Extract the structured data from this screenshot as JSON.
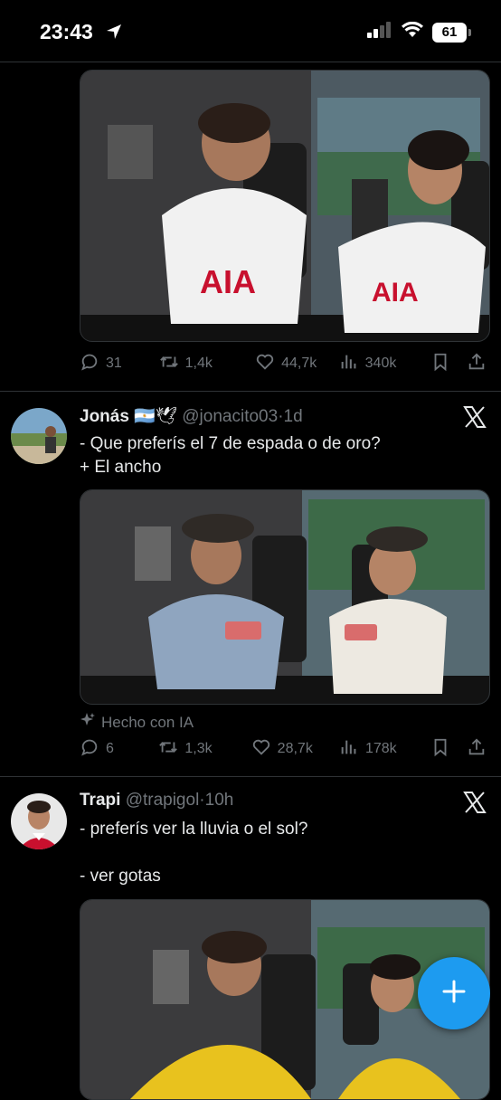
{
  "status_bar": {
    "time": "23:43",
    "battery": "61"
  },
  "tweets": [
    {
      "media_alt": "",
      "actions": {
        "replies": "31",
        "retweets": "1,4k",
        "likes": "44,7k",
        "views": "340k"
      }
    },
    {
      "name": "Jonás",
      "flags": "🇦🇷🕊",
      "handle": "@jonacito03",
      "time": "1d",
      "text": "- Que preferís el 7 de espada o de oro?\n+ El ancho",
      "ai_label": "Hecho con IA",
      "actions": {
        "replies": "6",
        "retweets": "1,3k",
        "likes": "28,7k",
        "views": "178k"
      }
    },
    {
      "name": "Trapi",
      "handle": "@trapigol",
      "time": "10h",
      "text": "- preferís ver la lluvia o el sol?\n\n- ver gotas"
    }
  ],
  "colors": {
    "accent": "#1d9bf0",
    "muted": "#71767b",
    "text": "#e7e9ea",
    "background": "#000000"
  }
}
